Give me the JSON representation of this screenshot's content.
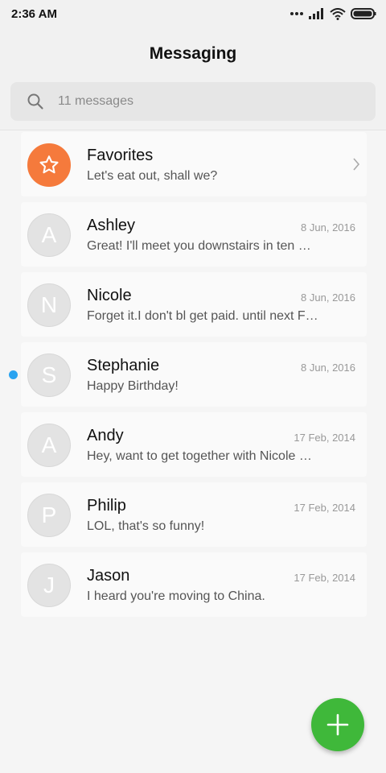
{
  "status_bar": {
    "time": "2:36 AM",
    "icons": [
      "more-dots-icon",
      "signal-icon",
      "wifi-icon",
      "battery-icon"
    ]
  },
  "header": {
    "title": "Messaging"
  },
  "search": {
    "placeholder": "11 messages"
  },
  "favorites": {
    "name": "Favorites",
    "preview": "Let's eat out, shall we?",
    "icon": "star-icon",
    "color": "#f57a3c"
  },
  "conversations": [
    {
      "initial": "A",
      "name": "Ashley",
      "preview": "Great! I'll meet you downstairs in ten …",
      "date": "8 Jun, 2016",
      "unread": false
    },
    {
      "initial": "N",
      "name": "Nicole",
      "preview": "Forget it.I don't bl get paid. until next F…",
      "date": "8 Jun, 2016",
      "unread": false
    },
    {
      "initial": "S",
      "name": "Stephanie",
      "preview": "Happy Birthday!",
      "date": "8 Jun, 2016",
      "unread": true
    },
    {
      "initial": "A",
      "name": "Andy",
      "preview": "Hey, want to get together with Nicole …",
      "date": "17 Feb, 2014",
      "unread": false
    },
    {
      "initial": "P",
      "name": "Philip",
      "preview": "LOL, that's so funny!",
      "date": "17 Feb, 2014",
      "unread": false
    },
    {
      "initial": "J",
      "name": "Jason",
      "preview": "I heard you're moving to China.",
      "date": "17 Feb, 2014",
      "unread": false
    }
  ],
  "colors": {
    "unread_dot": "#2aa3f0",
    "fab": "#3fb83a"
  },
  "fab": {
    "icon": "plus-icon"
  }
}
